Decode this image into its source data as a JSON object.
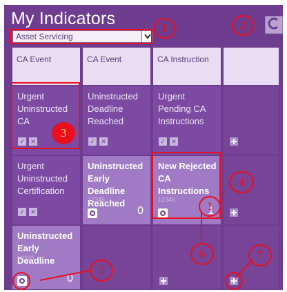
{
  "header": {
    "title": "My Indicators",
    "filter_selected": "Asset Servicing"
  },
  "columns": [
    "CA Event",
    "CA Event",
    "CA Instruction"
  ],
  "tiles": {
    "r1c1": "Urgent Uninstructed CA",
    "r1c2": "Uninstructed Deadline Reached",
    "r1c3": "Urgent Pending CA Instructions",
    "r2c1": "Urgent Uninstructed Certification",
    "r2c2": "Uninstructed Early Deadline Reached",
    "r2c2_sub": "12345",
    "r2c2_count": "0",
    "r2c3": "New Rejected CA Instructions",
    "r2c3_sub": "12345",
    "r2c3_count": "1",
    "r3c1": "Uninstructed Early Deadline",
    "r3c1_sub": "12345",
    "r3c1_count": "0"
  },
  "annotations": {
    "a1": "1",
    "a2": "2",
    "a3": "3",
    "a4": "4",
    "a5": "5",
    "a6": "6",
    "a7": "7",
    "a_count": "1"
  },
  "colors": {
    "panel": "#6e3d90",
    "tile": "#7c4aa2",
    "tile_highlight": "#a07ac4",
    "header_bg": "#e8ddf2",
    "annotation": "#e8101e"
  },
  "icons": {
    "check": "check-icon",
    "close": "close-icon",
    "plus": "plus-icon",
    "config": "gear-icon",
    "refresh": "refresh-icon",
    "dropdown": "chevron-down-icon"
  }
}
